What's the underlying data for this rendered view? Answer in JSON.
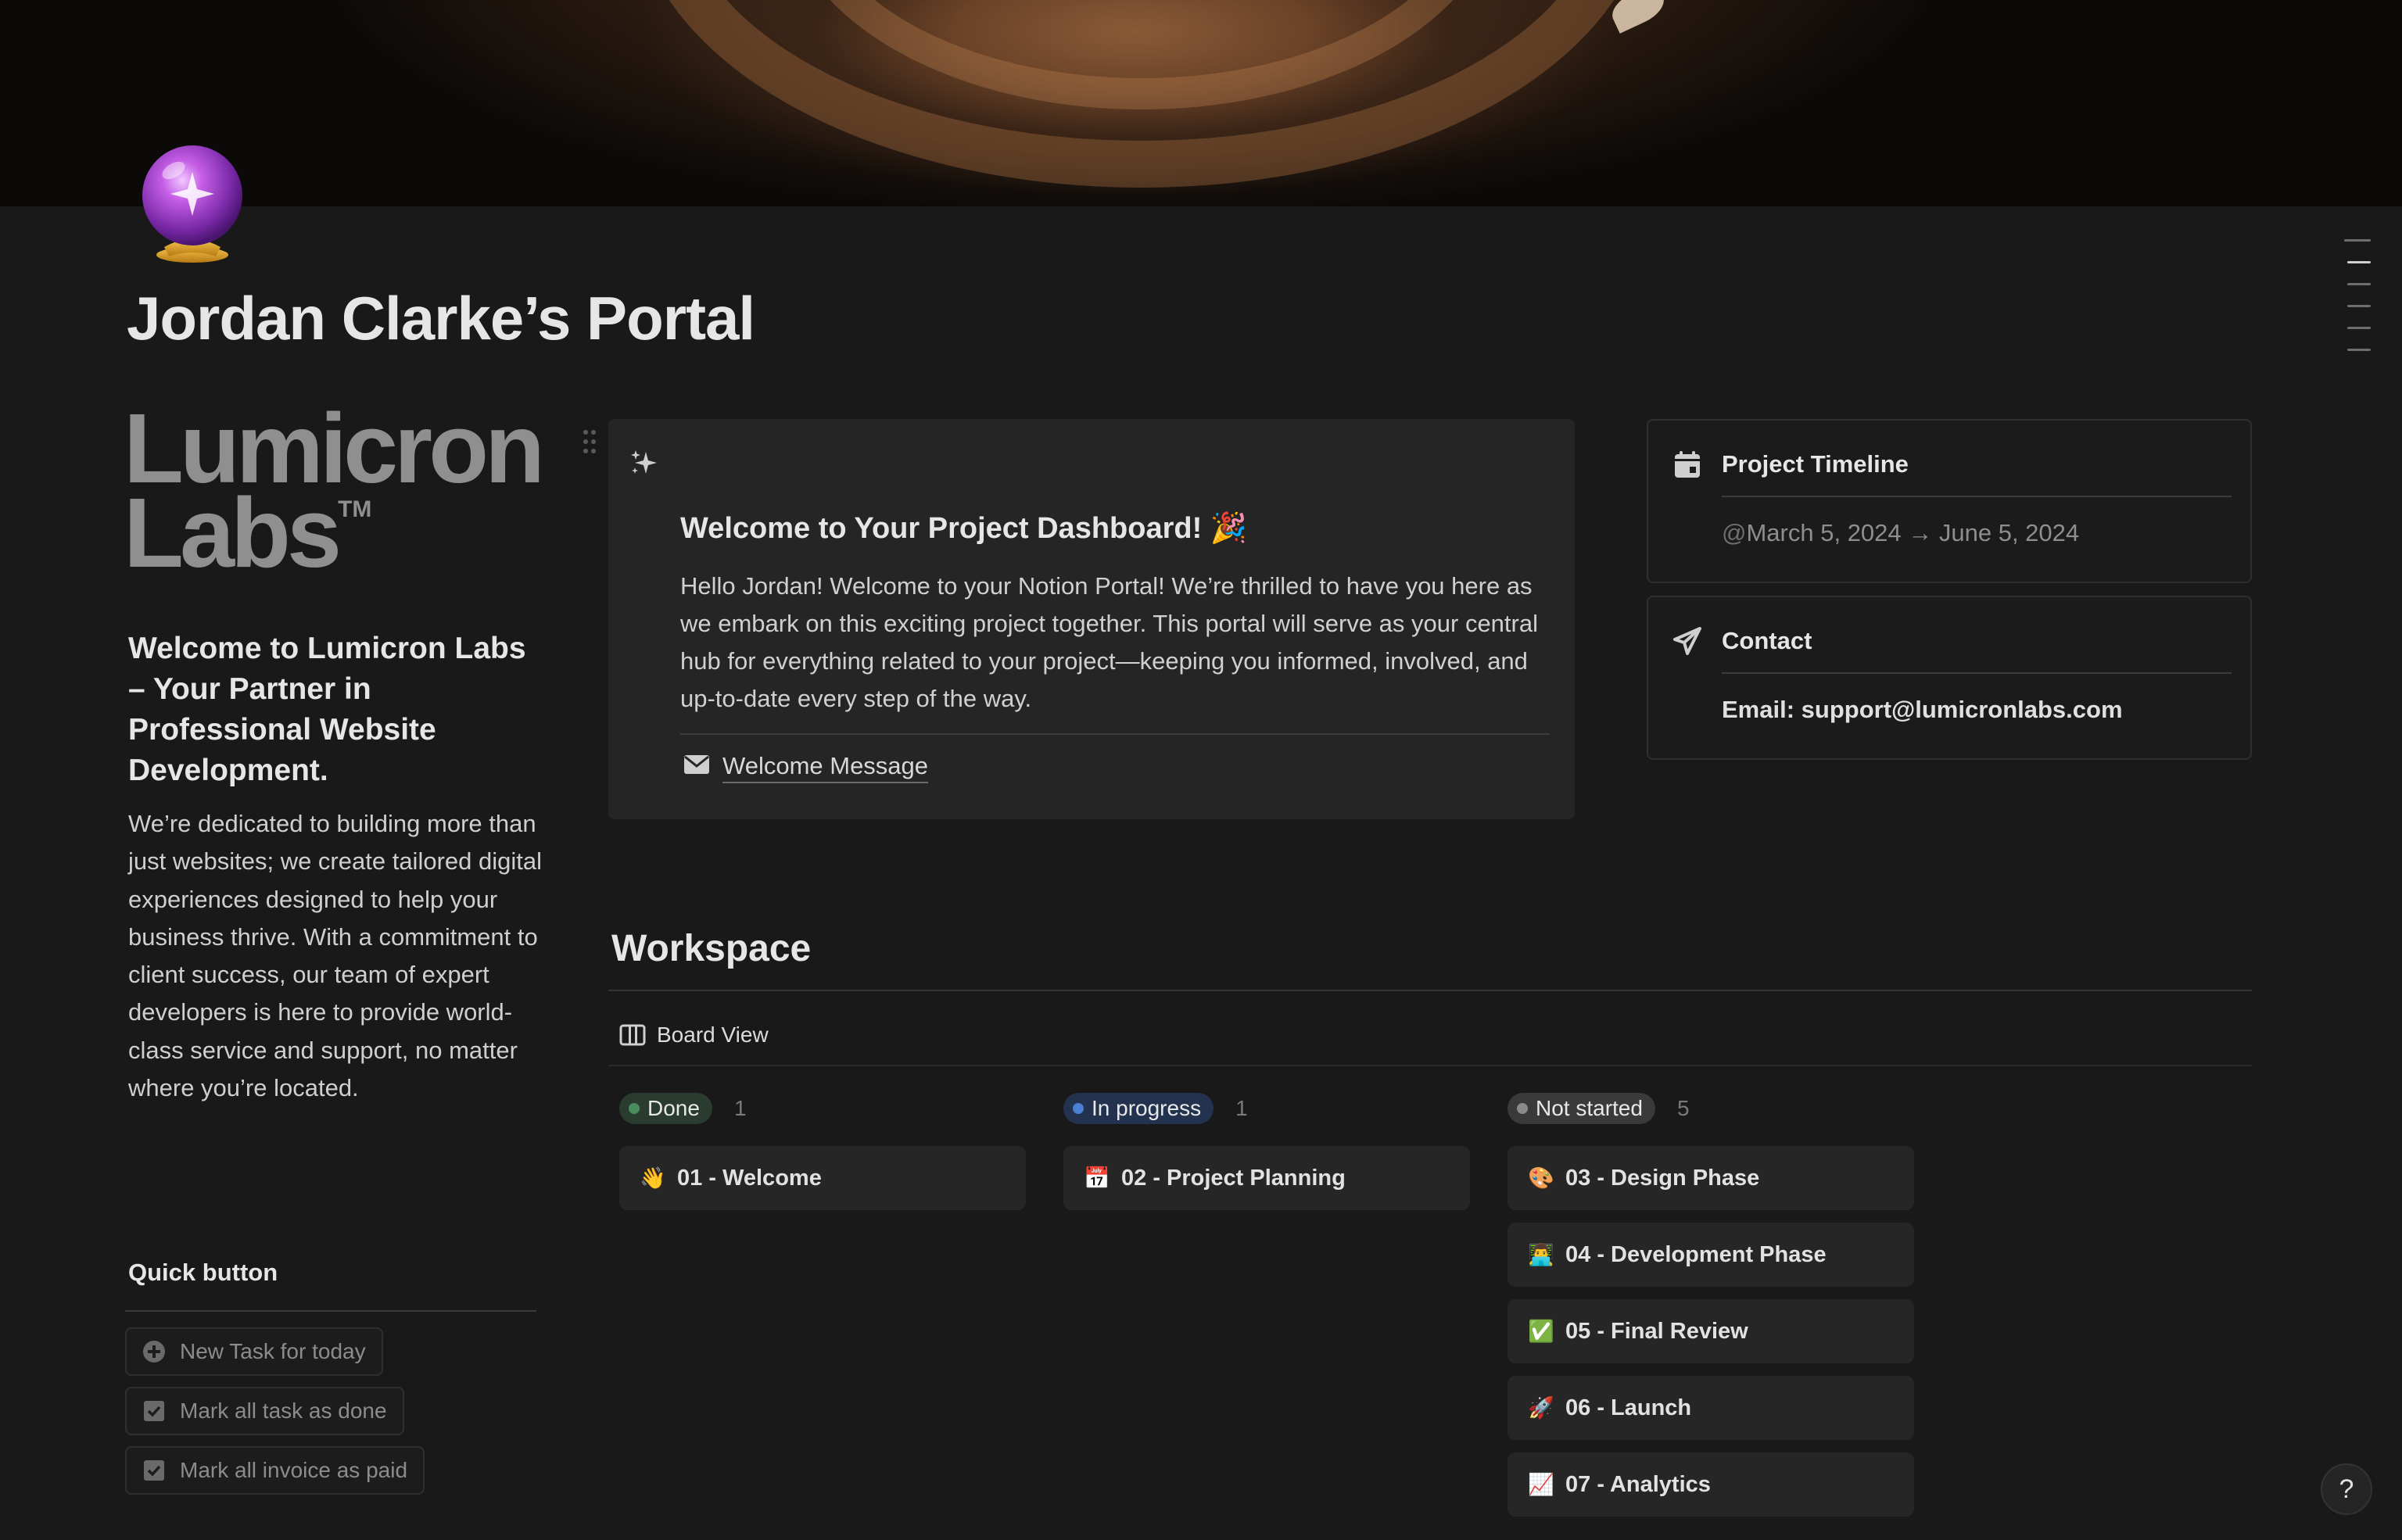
{
  "page": {
    "title": "Jordan Clarke’s Portal",
    "icon": "crystal-ball-icon"
  },
  "logo": {
    "line1": "Lumicron",
    "line2": "Labs",
    "tm": "TM"
  },
  "intro": {
    "heading": "Welcome to Lumicron Labs – Your Partner in Professional Website Development.",
    "paragraph": "We’re dedicated to building more than just websites; we create tailored digital experiences designed to help your business thrive. With a commitment to client success, our team of expert developers is here to provide world-class service and support, no matter where you’re located."
  },
  "quick": {
    "title": "Quick button",
    "buttons": [
      {
        "label": "New Task for today",
        "icon": "plus-circle-icon"
      },
      {
        "label": "Mark all task as done",
        "icon": "checkbox-icon"
      },
      {
        "label": "Mark all invoice as paid",
        "icon": "checkbox-icon"
      }
    ]
  },
  "callout": {
    "icon": "sparkles-icon",
    "heading": "Welcome to Your Project Dashboard! 🎉",
    "body": "Hello Jordan! Welcome to your Notion Portal! We’re thrilled to have you here as we embark on this exciting project together. This portal will serve as your central hub for everything related to your project—keeping you informed, involved, and up-to-date every step of the way.",
    "link_label": "Welcome Message",
    "link_icon": "envelope-icon"
  },
  "timeline": {
    "title": "Project Timeline",
    "at": "@",
    "value": "March 5, 2024 → June 5, 2024",
    "icon": "calendar-icon"
  },
  "contact": {
    "title": "Contact",
    "value": "Email: support@lumicronlabs.com",
    "icon": "paper-plane-icon"
  },
  "workspace": {
    "title": "Workspace",
    "view_label": "Board View",
    "columns": [
      {
        "status": "Done",
        "count": "1",
        "color": "#4a8c5c",
        "bg": "#2a3b2f",
        "cards": [
          {
            "emoji": "👋",
            "label": "01 - Welcome"
          }
        ]
      },
      {
        "status": "In progress",
        "count": "1",
        "color": "#4a7fd4",
        "bg": "#23334f",
        "cards": [
          {
            "emoji": "📅",
            "label": "02 - Project Planning"
          }
        ]
      },
      {
        "status": "Not started",
        "count": "5",
        "color": "#8a8a8a",
        "bg": "#3a3a3a",
        "cards": [
          {
            "emoji": "🎨",
            "label": "03 - Design Phase"
          },
          {
            "emoji": "👨‍💻",
            "label": "04 - Development Phase"
          },
          {
            "emoji": "✅",
            "label": "05 - Final Review"
          },
          {
            "emoji": "🚀",
            "label": "06 - Launch"
          },
          {
            "emoji": "📈",
            "label": "07 - Analytics"
          }
        ]
      }
    ]
  },
  "help": {
    "label": "?"
  }
}
